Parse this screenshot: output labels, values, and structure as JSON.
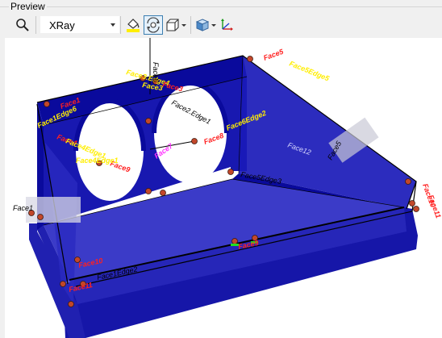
{
  "group": {
    "label": "Preview"
  },
  "toolbar": {
    "zoom_tooltip": "Zoom",
    "display_mode": {
      "selected": "XRay"
    },
    "icons": [
      "magnifier-icon",
      "paint-bucket-icon",
      "rotate-view-icon",
      "box-view-icon",
      "shading-cube-icon",
      "axis-triad-icon"
    ]
  },
  "viewport": {
    "labels": {
      "top_face": "Face3",
      "right_face": "Face5",
      "left_face": "Face1",
      "top_edge": "Face3.Edge4",
      "inner_edge": "Face2.Edge1",
      "right_top": "Face5",
      "right_text": "Face5Edge5",
      "left_red": "Face1",
      "left_yellow": "Face1Edge6",
      "arc_red": "Face4",
      "arc_yellow": "Face4Edge1",
      "circle_edge": "Face6",
      "circle_y": "Face6Edge2",
      "magenta": "Face7",
      "center_red": "Face8",
      "bottom_red": "Face9",
      "right_side1": "Face10",
      "right_side2": "Face11",
      "back_text": "Face12",
      "frame_text1": "Face5Edge3",
      "frame_text2": "Face1Edge2"
    }
  },
  "colors": {
    "solid_blue": "#0a0a9c",
    "light_blue": "#3b3bc8",
    "pin": "#c2472a",
    "yellow": "#ffee00",
    "red": "#ff2020",
    "magenta": "#ff33ff",
    "selection": "#3c7fb1"
  }
}
